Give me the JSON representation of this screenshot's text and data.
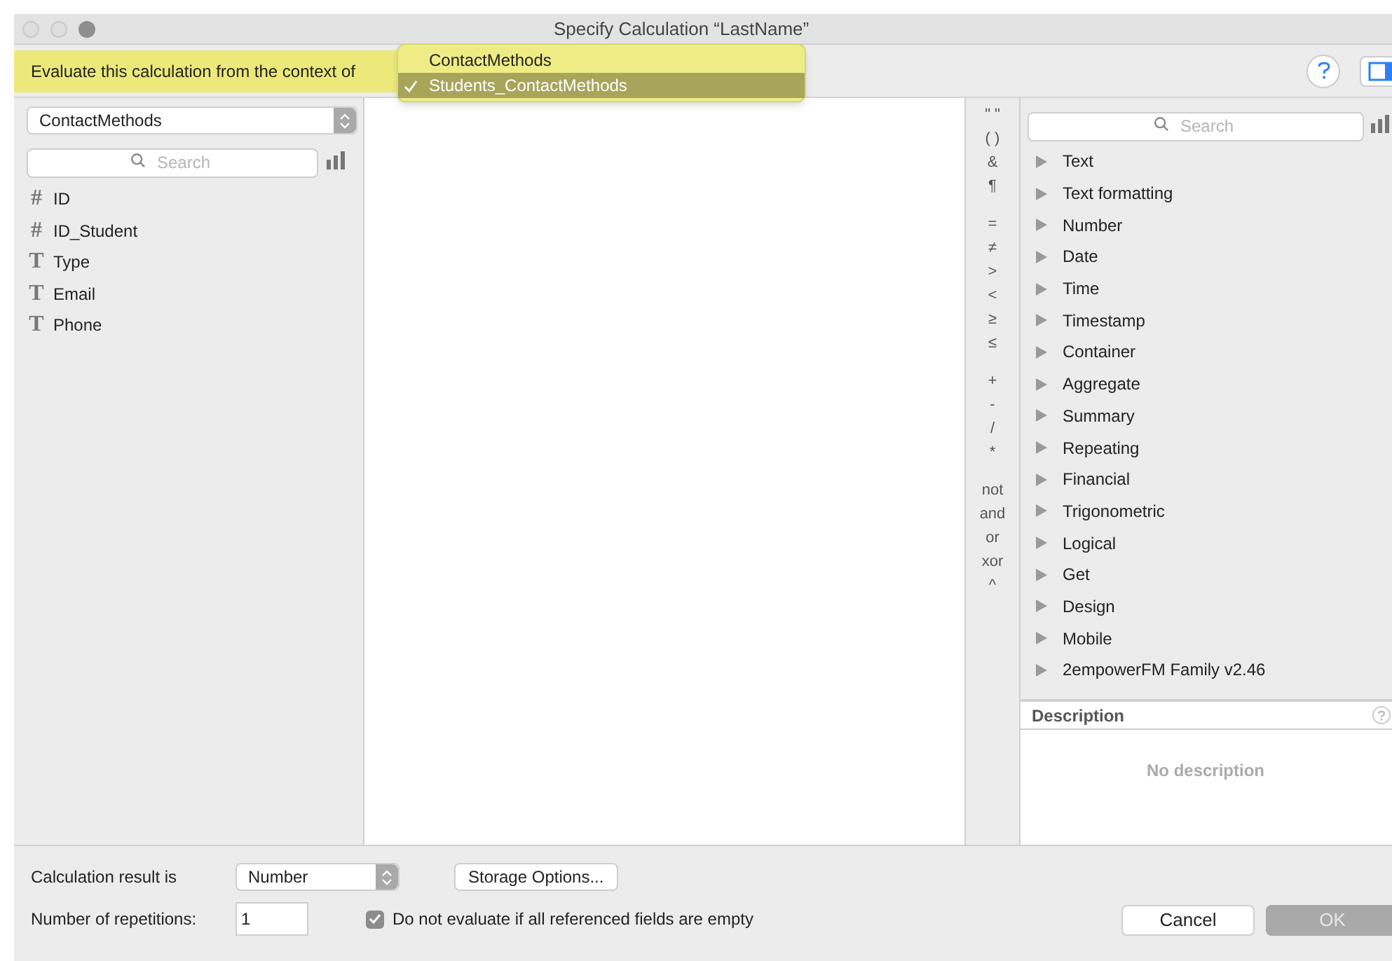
{
  "window": {
    "title": "Specify Calculation “LastName”"
  },
  "context": {
    "label": "Evaluate this calculation from the context of",
    "menu": [
      {
        "label": "ContactMethods",
        "selected": false
      },
      {
        "label": "Students_ContactMethods",
        "selected": true
      }
    ]
  },
  "left_panel": {
    "table_select": "ContactMethods",
    "search": {
      "placeholder": "Search"
    },
    "fields": [
      {
        "glyph": "#",
        "name": "ID"
      },
      {
        "glyph": "#",
        "name": "ID_Student"
      },
      {
        "glyph": "T",
        "name": "Type"
      },
      {
        "glyph": "T",
        "name": "Email"
      },
      {
        "glyph": "T",
        "name": "Phone"
      }
    ]
  },
  "operator_groups": [
    [
      "\" \"",
      "( )",
      "&",
      "¶"
    ],
    [
      "=",
      "≠",
      ">",
      "<",
      "≥",
      "≤"
    ],
    [
      "+",
      "-",
      "/",
      "*"
    ],
    [
      "not",
      "and",
      "or",
      "xor",
      "^"
    ]
  ],
  "functions": {
    "search": {
      "placeholder": "Search"
    },
    "categories": [
      "Text",
      "Text formatting",
      "Number",
      "Date",
      "Time",
      "Timestamp",
      "Container",
      "Aggregate",
      "Summary",
      "Repeating",
      "Financial",
      "Trigonometric",
      "Logical",
      "Get",
      "Design",
      "Mobile",
      "2empowerFM Family v2.46"
    ]
  },
  "description": {
    "title": "Description",
    "text": "No description"
  },
  "footer": {
    "result_label": "Calculation result is",
    "result_type": "Number",
    "storage_button": "Storage Options...",
    "repetitions_label": "Number of repetitions:",
    "repetitions": "1",
    "dont_evaluate": {
      "label": "Do not evaluate if all referenced fields are empty",
      "checked": true
    },
    "buttons": [
      {
        "label": "Cancel",
        "disabled": false
      },
      {
        "label": "OK",
        "disabled": true
      }
    ]
  }
}
